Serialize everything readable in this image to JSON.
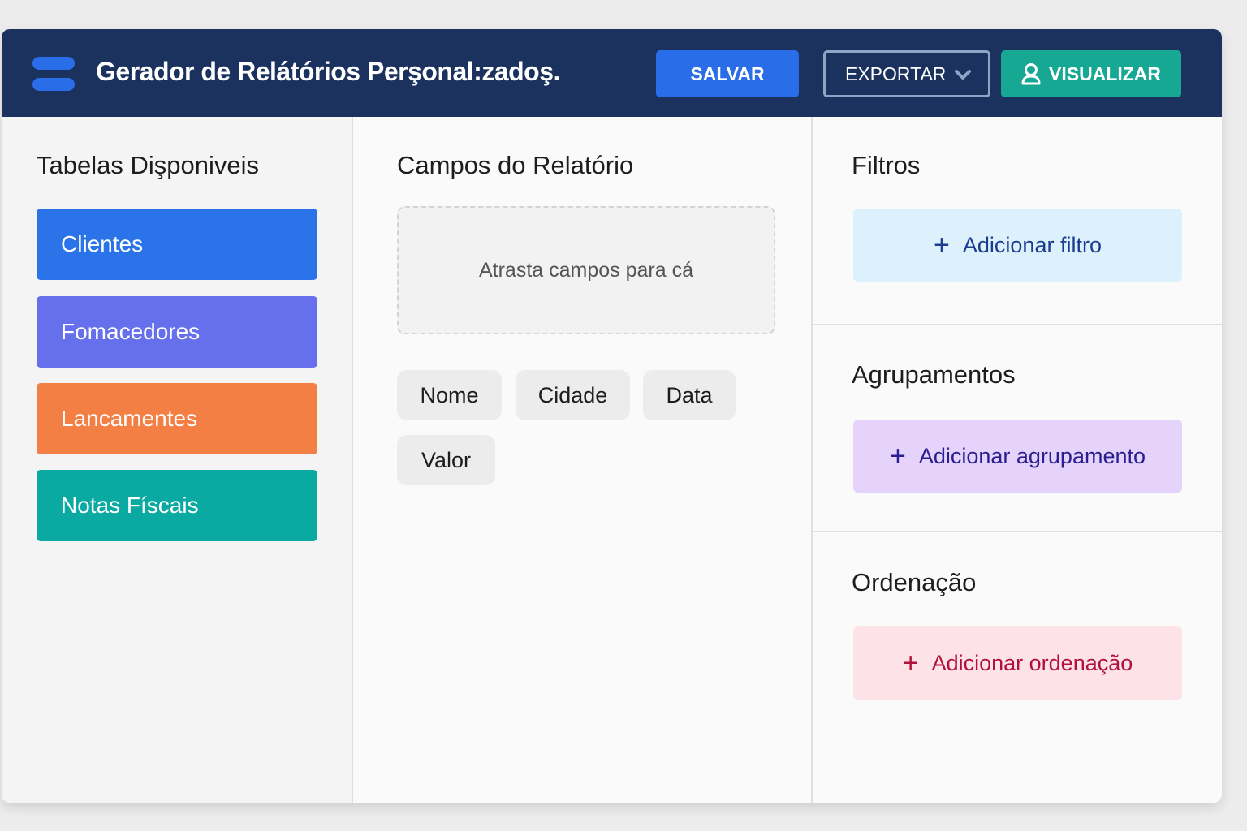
{
  "header": {
    "title": "Gerador de Relátórios Perşonal:zadoş.",
    "save_label": "SALVAR",
    "export_label": "EXPORTAR",
    "view_label": "VISUALIZAR"
  },
  "tables": {
    "title": "Tabelas Dişponiveis",
    "items": [
      {
        "label": "Clientes",
        "color": "#2a73e8"
      },
      {
        "label": "Fomacedores",
        "color": "#6670ec"
      },
      {
        "label": "Lancamentes",
        "color": "#f47f45"
      },
      {
        "label": "Notas Físcais",
        "color": "#0aa9a1"
      }
    ]
  },
  "fields": {
    "title": "Campos do Relatório",
    "dropzone_text": "Atrasta campos para cá",
    "chips": [
      "Nome",
      "Cidade",
      "Data",
      "Valor"
    ]
  },
  "filters": {
    "title": "Filtros",
    "add_label": "Adicionar filtro",
    "bg": "#dcf1fb",
    "fg": "#1b3d8f"
  },
  "groupings": {
    "title": "Agrupamentos",
    "add_label": "Adicionar agrupamento",
    "bg": "#e5d3fb",
    "fg": "#2a1f8f"
  },
  "sorting": {
    "title": "Ordenação",
    "add_label": "Adicionar ordenação",
    "bg": "#fde2e8",
    "fg": "#b2123a"
  },
  "colors": {
    "header_bg": "#1b325f",
    "accent_blue": "#2a6de9",
    "accent_teal": "#17a894"
  },
  "icons": {
    "menu": "menu-icon",
    "export_chevron": "chevron-down-icon",
    "view": "user-icon",
    "plus": "plus-icon"
  }
}
